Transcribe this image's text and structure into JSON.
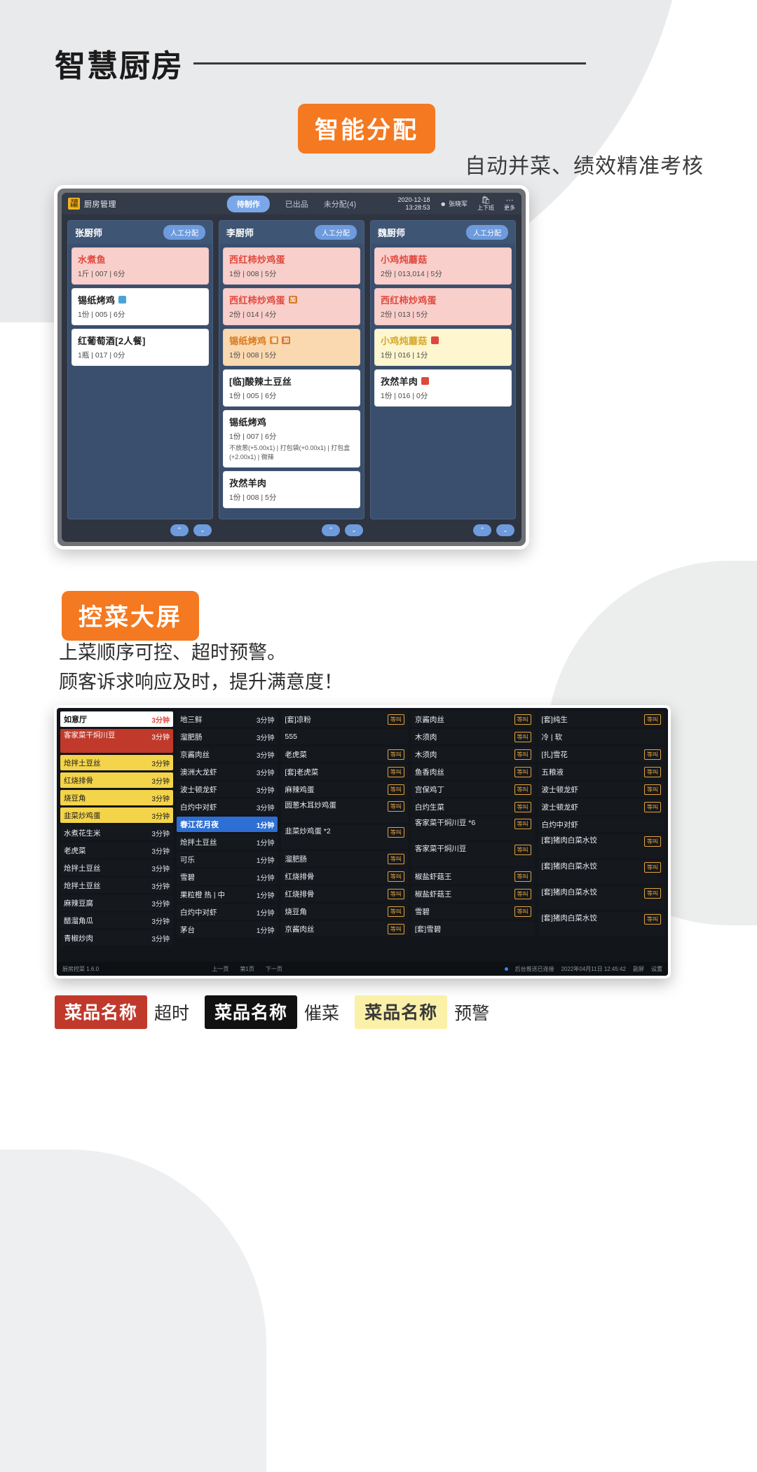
{
  "header": {
    "title": "智慧厨房"
  },
  "section1": {
    "pill": "智能分配",
    "subtitle": "自动并菜、绩效精准考核"
  },
  "section2": {
    "pill": "控菜大屏",
    "subtitle_line1": "上菜顺序可控、超时预警。",
    "subtitle_line2": "顾客诉求响应及时，提升满意度！"
  },
  "app1": {
    "logo_text": "天商财能",
    "title": "厨房管理",
    "tabs": [
      {
        "label": "待制作",
        "active": true
      },
      {
        "label": "已出品",
        "active": false
      },
      {
        "label": "未分配(4)",
        "active": false
      }
    ],
    "date": "2020-12-18",
    "time": "13:28:53",
    "user": "张晓军",
    "shift_icon": "shopping-bag-icon",
    "shift_label": "上下班",
    "more_icon": "ellipsis-icon",
    "more_label": "更多",
    "manual_assign_label": "人工分配",
    "pager_up": "⌃",
    "pager_down": "⌄",
    "columns": [
      {
        "chef": "张厨师",
        "dishes": [
          {
            "name": "水煮鱼",
            "meta": "1斤 | 007 | 6分",
            "style": "pink",
            "tags": [],
            "opts": ""
          },
          {
            "name": "锡纸烤鸡",
            "meta": "1份 | 005 | 6分",
            "style": "white",
            "tags": [
              "blue-square"
            ],
            "opts": ""
          },
          {
            "name": "红葡萄酒[2人餐]",
            "meta": "1瓶 | 017 | 0分",
            "style": "white",
            "tags": [],
            "opts": ""
          }
        ]
      },
      {
        "chef": "李厨师",
        "dishes": [
          {
            "name": "西红柿炒鸡蛋",
            "meta": "1份 | 008 | 5分",
            "style": "pink",
            "tags": [],
            "opts": ""
          },
          {
            "name": "西红柿炒鸡蛋",
            "meta": "2份 | 014 | 4分",
            "style": "pink",
            "tags": [
              "加"
            ],
            "opts": ""
          },
          {
            "name": "锡纸烤鸡",
            "meta": "1份 | 008 | 5分",
            "style": "orange",
            "tags": [
              "催",
              "加"
            ],
            "opts": ""
          },
          {
            "name": "[临]酸辣土豆丝",
            "meta": "1份 | 005 | 6分",
            "style": "white",
            "tags": [],
            "opts": ""
          },
          {
            "name": "锡纸烤鸡",
            "meta": "1份 | 007 | 6分",
            "style": "white",
            "tags": [],
            "opts": "不放葱(+5.00x1) | 打包袋(+0.00x1) | 打包盒(+2.00x1) | 微辣"
          },
          {
            "name": "孜然羊肉",
            "meta": "1份 | 008 | 5分",
            "style": "white",
            "tags": [],
            "opts": ""
          }
        ]
      },
      {
        "chef": "魏厨师",
        "dishes": [
          {
            "name": "小鸡炖蘑菇",
            "meta": "2份 | 013,014 | 5分",
            "style": "pink",
            "tags": [],
            "opts": ""
          },
          {
            "name": "西红柿炒鸡蛋",
            "meta": "2份 | 013 | 5分",
            "style": "pink",
            "tags": [],
            "opts": ""
          },
          {
            "name": "小鸡炖蘑菇",
            "meta": "1份 | 016 | 1分",
            "style": "yellow",
            "tags": [
              "red-square"
            ],
            "opts": ""
          },
          {
            "name": "孜然羊肉",
            "meta": "1份 | 016 | 0分",
            "style": "white",
            "tags": [
              "red-square"
            ],
            "opts": ""
          }
        ]
      }
    ]
  },
  "app2": {
    "columns": [
      {
        "rows": [
          {
            "name": "如意厅",
            "time": "3分钟",
            "style": "hdr"
          },
          {
            "name": "客家菜干焖川豆",
            "time": "3分钟",
            "style": "over",
            "two": true
          },
          {
            "name": "炝拌土豆丝",
            "time": "3分钟",
            "style": "warn"
          },
          {
            "name": "红烧排骨",
            "time": "3分钟",
            "style": "warn"
          },
          {
            "name": "烧豆角",
            "time": "3分钟",
            "style": "warn"
          },
          {
            "name": "韭菜炒鸡蛋",
            "time": "3分钟",
            "style": "warn"
          },
          {
            "name": "水煮花生米",
            "time": "3分钟",
            "style": "plain"
          },
          {
            "name": "老虎菜",
            "time": "3分钟",
            "style": "plain"
          },
          {
            "name": "炝拌土豆丝",
            "time": "3分钟",
            "style": "plain"
          },
          {
            "name": "炝拌土豆丝",
            "time": "3分钟",
            "style": "plain"
          },
          {
            "name": "麻辣豆腐",
            "time": "3分钟",
            "style": "plain"
          },
          {
            "name": "醋溜角瓜",
            "time": "3分钟",
            "style": "plain"
          },
          {
            "name": "青椒炒肉",
            "time": "3分钟",
            "style": "plain"
          }
        ]
      },
      {
        "rows": [
          {
            "name": "地三鲜",
            "time": "3分钟",
            "style": "plain"
          },
          {
            "name": "溜肥肠",
            "time": "3分钟",
            "style": "plain"
          },
          {
            "name": "京酱肉丝",
            "time": "3分钟",
            "style": "plain"
          },
          {
            "name": "澳洲大龙虾",
            "time": "3分钟",
            "style": "plain"
          },
          {
            "name": "波士顿龙虾",
            "time": "3分钟",
            "style": "plain"
          },
          {
            "name": "白灼中对虾",
            "time": "3分钟",
            "style": "plain"
          },
          {
            "name": "春江花月夜",
            "time": "1分钟",
            "style": "hdr-blue"
          },
          {
            "name": "炝拌土豆丝",
            "time": "1分钟",
            "style": "plain"
          },
          {
            "name": "可乐",
            "time": "1分钟",
            "style": "plain"
          },
          {
            "name": "雪碧",
            "time": "1分钟",
            "style": "plain"
          },
          {
            "name": "果粒橙",
            "time": "1分钟",
            "style": "plain",
            "sub": "热 | 中"
          },
          {
            "name": "白灼中对虾",
            "time": "1分钟",
            "style": "plain"
          },
          {
            "name": "茅台",
            "time": "1分钟",
            "style": "plain"
          }
        ]
      },
      {
        "rows": [
          {
            "name": "[套]凉粉",
            "badge": "等叫",
            "style": "plain"
          },
          {
            "name": "555",
            "badge": "",
            "style": "plain"
          },
          {
            "name": "老虎菜",
            "badge": "等叫",
            "style": "plain"
          },
          {
            "name": "[套]老虎菜",
            "badge": "等叫",
            "style": "plain"
          },
          {
            "name": "麻辣鸡蛋",
            "badge": "等叫",
            "style": "plain"
          },
          {
            "name": "圆葱木耳炒鸡蛋",
            "badge": "等叫",
            "style": "plain",
            "two": true
          },
          {
            "name": "韭菜炒鸡蛋 *2",
            "badge": "等叫",
            "style": "plain",
            "two": true
          },
          {
            "name": "溜肥肠",
            "badge": "等叫",
            "style": "plain"
          },
          {
            "name": "红烧排骨",
            "badge": "等叫",
            "style": "plain"
          },
          {
            "name": "红烧排骨",
            "badge": "等叫",
            "style": "plain"
          },
          {
            "name": "烧豆角",
            "badge": "等叫",
            "style": "plain"
          },
          {
            "name": "京酱肉丝",
            "badge": "等叫",
            "style": "plain"
          }
        ]
      },
      {
        "rows": [
          {
            "name": "京酱肉丝",
            "badge": "等叫",
            "style": "plain"
          },
          {
            "name": "木须肉",
            "badge": "等叫",
            "style": "plain"
          },
          {
            "name": "木须肉",
            "badge": "等叫",
            "style": "plain"
          },
          {
            "name": "鱼香肉丝",
            "badge": "等叫",
            "style": "plain"
          },
          {
            "name": "宫保鸡丁",
            "badge": "等叫",
            "style": "plain"
          },
          {
            "name": "白灼生菜",
            "badge": "等叫",
            "style": "plain"
          },
          {
            "name": "客家菜干焖川豆 *6",
            "badge": "等叫",
            "style": "plain",
            "two": true
          },
          {
            "name": "客家菜干焖川豆",
            "badge": "等叫",
            "style": "plain",
            "two": true
          },
          {
            "name": "椒盐虾菇王",
            "badge": "等叫",
            "style": "plain"
          },
          {
            "name": "椒盐虾菇王",
            "badge": "等叫",
            "style": "plain"
          },
          {
            "name": "雪碧",
            "badge": "等叫",
            "style": "plain"
          },
          {
            "name": "[套]雪碧",
            "badge": "",
            "style": "plain"
          }
        ]
      },
      {
        "rows": [
          {
            "name": "[套]纯生",
            "badge": "等叫",
            "style": "plain"
          },
          {
            "name": "冷 | 软",
            "badge": "",
            "style": "plain"
          },
          {
            "name": "[扎]雪花",
            "badge": "等叫",
            "style": "plain"
          },
          {
            "name": "五粮液",
            "badge": "等叫",
            "style": "plain"
          },
          {
            "name": "波士顿龙虾",
            "badge": "等叫",
            "style": "plain"
          },
          {
            "name": "波士顿龙虾",
            "badge": "等叫",
            "style": "plain"
          },
          {
            "name": "白灼中对虾",
            "badge": "",
            "style": "plain"
          },
          {
            "name": "[套]猪肉白菜水饺",
            "badge": "等叫",
            "style": "plain",
            "two": true
          },
          {
            "name": "[套]猪肉白菜水饺",
            "badge": "等叫",
            "style": "plain",
            "two": true
          },
          {
            "name": "[套]猪肉白菜水饺",
            "badge": "等叫",
            "style": "plain",
            "two": true
          },
          {
            "name": "[套]猪肉白菜水饺",
            "badge": "等叫",
            "style": "plain",
            "two": true
          }
        ]
      }
    ],
    "footer": {
      "app_name": "厨房控菜 1.6.0",
      "prev": "上一页",
      "page": "第1页",
      "next": "下一页",
      "status": "后台推送已连接",
      "time": "2022年04月11日 12:45:42",
      "fullscreen": "副屏",
      "settings": "设置"
    }
  },
  "legend": [
    {
      "chip": "菜品名称",
      "label": "超时",
      "style": "over"
    },
    {
      "chip": "菜品名称",
      "label": "催菜",
      "style": "cui"
    },
    {
      "chip": "菜品名称",
      "label": "预警",
      "style": "warn"
    }
  ],
  "colors": {
    "accent_orange": "#f47920",
    "overtime_red": "#c0392b",
    "warn_yellow": "#f3d44a",
    "blue": "#2d6fd4"
  }
}
